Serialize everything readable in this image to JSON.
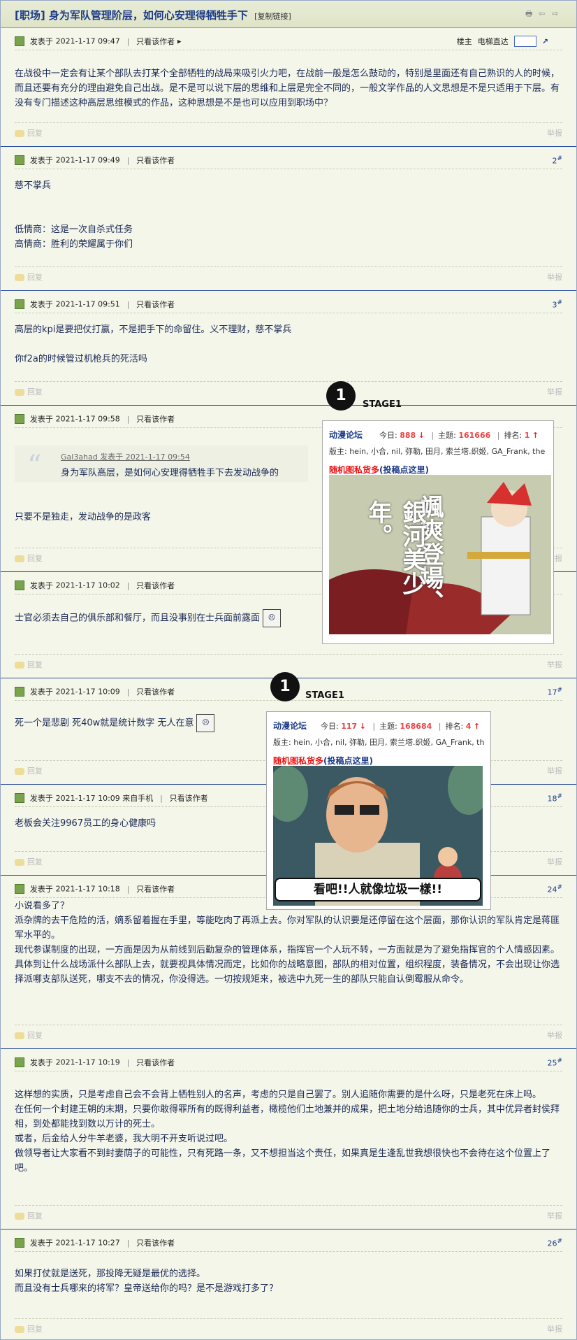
{
  "thread": {
    "title": "[职场] 身为军队管理阶层，如何心安理得牺牲手下",
    "copy_link": "[复制链接]"
  },
  "labels": {
    "posted_at": "发表于",
    "only_author": "只看该作者",
    "reply": "回复",
    "report": "举报",
    "op": "楼主",
    "elevator": "电梯直达"
  },
  "posts": [
    {
      "time": "2021-1-17 09:47",
      "floor": "",
      "lines": [
        "在战役中一定会有让某个部队去打某个全部牺牲的战局来吸引火力吧，在战前一般是怎么鼓动的，特别是里面还有自己熟识的人的时候，而且还要有充分的理由避免自己出战。是不是可以说下层的思维和上层是完全不同的，一般文学作品的人文思想是不是只适用于下层。有没有专门描述这种高层思维模式的作品，这种思想是不是也可以应用到职场中？"
      ]
    },
    {
      "time": "2021-1-17 09:49",
      "floor": "2",
      "lines": [
        "慈不掌兵",
        "",
        "",
        "低情商：这是一次自杀式任务",
        "高情商：胜利的荣耀属于你们"
      ]
    },
    {
      "time": "2021-1-17 09:51",
      "floor": "3",
      "lines": [
        "高层的kpi是要把仗打赢，不是把手下的命留住。义不理财，慈不掌兵",
        "",
        "你f2a的时候管过机枪兵的死活吗"
      ]
    },
    {
      "time": "2021-1-17 09:58",
      "floor": "",
      "quote_author": "Gal3ahad 发表于 2021-1-17 09:54",
      "quote_text": "身为军队高层，是如何心安理得牺牲手下去发动战争的",
      "lines": [
        "只要不是独走，发动战争的是政客"
      ]
    },
    {
      "time": "2021-1-17 10:02",
      "floor": "",
      "lines": [
        "士官必须去自己的俱乐部和餐厅，而且没事别在士兵面前露面"
      ]
    },
    {
      "time": "2021-1-17 10:09",
      "floor": "17",
      "lines": [
        "死一个是悲剧 死40w就是统计数字 无人在意"
      ]
    },
    {
      "time": "2021-1-17 10:09 来自手机",
      "floor": "18",
      "lines": [
        "老板会关注9967员工的身心健康吗"
      ]
    },
    {
      "time": "2021-1-17 10:18",
      "floor": "24",
      "lines": [
        "小说看多了？",
        "派杂牌的去干危险的活，嫡系留着握在手里，等能吃肉了再派上去。你对军队的认识要是还停留在这个层面，那你认识的军队肯定是蒋匪军水平的。",
        "现代参谋制度的出现，一方面是因为从前线到后勤复杂的管理体系，指挥官一个人玩不转，一方面就是为了避免指挥官的个人情感因素。",
        "具体到让什么战场派什么部队上去，就要视具体情况而定，比如你的战略意图，部队的相对位置，组织程度，装备情况，不会出现让你选择派哪支部队送死，哪支不去的情况，你没得选。一切按规矩来，被选中九死一生的部队只能自认倒霉服从命令。"
      ]
    },
    {
      "time": "2021-1-17 10:19",
      "floor": "25",
      "lines": [
        "这样想的实质，只是考虑自己会不会背上牺牲别人的名声，考虑的只是自己罢了。别人追随你需要的是什么呀，只是老死在床上吗。",
        "在任何一个封建王朝的末期，只要你敢得罪所有的既得利益者，橄榄他们土地兼并的成果，把土地分给追随你的士兵，其中优异者封侯拜相，到处都能找到数以万计的死士。",
        "或者，后金给人分牛羊老婆，我大明不开支听说过吧。",
        "做领导者让大家看不到封妻荫子的可能性，只有死路一条，又不想担当这个责任，如果真是生逢乱世我想很快也不会待在这个位置上了吧。"
      ]
    },
    {
      "time": "2021-1-17 10:27",
      "floor": "26",
      "lines": [
        "如果打仗就是送死，那投降无疑是最优的选择。",
        "而且没有士兵哪来的将军？皇帝送给你的吗？是不是游戏打多了？"
      ]
    }
  ],
  "cards": [
    {
      "stage": "STAGE1",
      "badge": "1",
      "forum": "动漫论坛",
      "today_label": "今日:",
      "today": "888",
      "topics_label": "主题:",
      "topics": "161666",
      "rank_label": "排名:",
      "rank": "1",
      "mods": "版主: hein, 小合, nil, 弥勒, 田月, 索兰塔.织姬, GA_Frank, the",
      "random_label": "随机图私货多",
      "submit_label": "(投稿点这里)",
      "image_text_1": "颯爽登場、",
      "image_text_2": "銀河美少年。"
    },
    {
      "stage": "STAGE1",
      "badge": "1",
      "forum": "动漫论坛",
      "today_label": "今日:",
      "today": "117",
      "topics_label": "主题:",
      "topics": "168684",
      "rank_label": "排名:",
      "rank": "4",
      "mods": "版主: hein, 小合, nil, 弥勒, 田月, 索兰塔.织姬, GA_Frank, th",
      "random_label": "随机图私货多",
      "submit_label": "(投稿点这里)",
      "image_text_1": "看吧!!人就像垃圾一樣!!"
    }
  ],
  "colors": {
    "accent": "#1c3a88",
    "border": "#2a4b9a",
    "hot": "#e44"
  }
}
